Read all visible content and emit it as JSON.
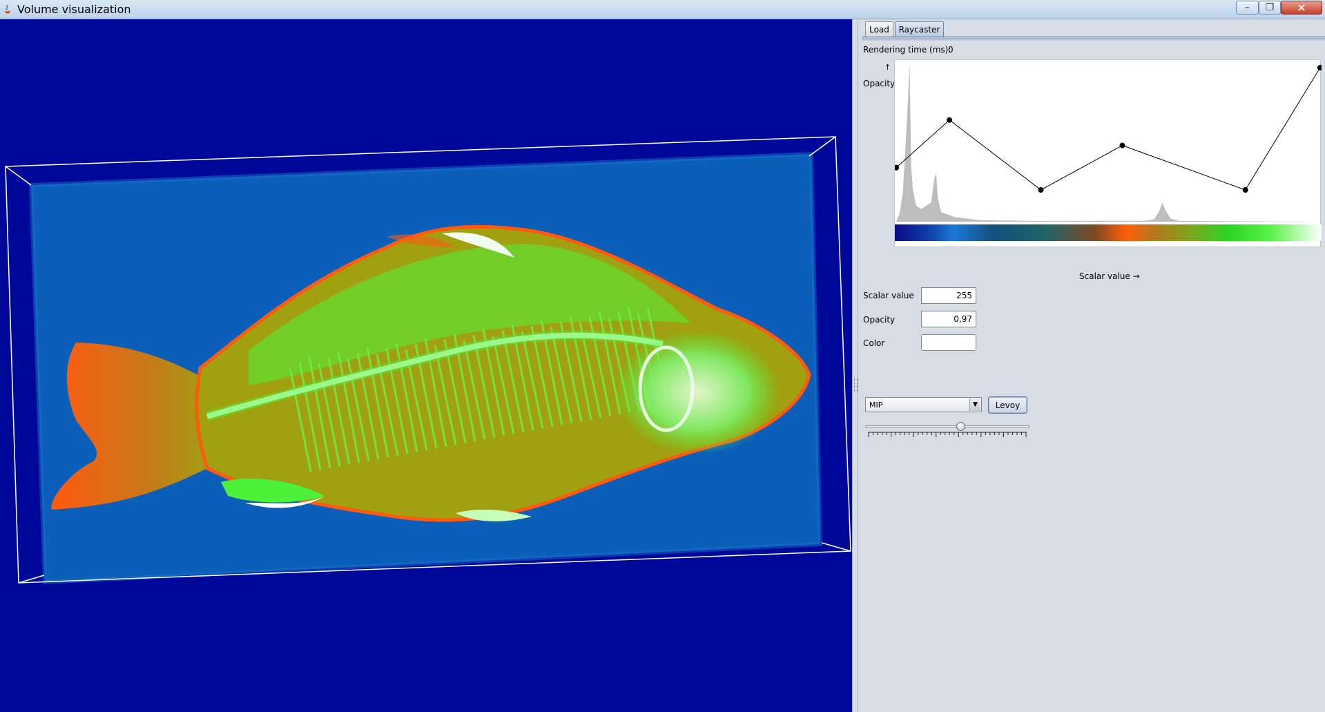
{
  "window": {
    "title": "Volume visualization",
    "controls": [
      "minimize",
      "maximize",
      "close"
    ]
  },
  "tabs": [
    {
      "label": "Load",
      "selected": false
    },
    {
      "label": "Raycaster",
      "selected": true
    }
  ],
  "panel": {
    "rendering_time_label": "Rendering time (ms):",
    "rendering_time_value": "0",
    "opacity_axis_arrow": "↑",
    "opacity_axis_label": "Opacity",
    "scalar_axis_label": "Scalar value →",
    "fields": {
      "scalar_value_label": "Scalar value",
      "scalar_value": "255",
      "opacity_label": "Opacity",
      "opacity": "0,97",
      "color_label": "Color",
      "color": "#ffffff"
    },
    "render_mode": {
      "selected": "MIP"
    },
    "levoy_label": "Levoy",
    "slider": {
      "value_fraction": 0.58,
      "tick_count": 36
    }
  },
  "transfer_function": {
    "control_points": [
      {
        "scalar": 0,
        "opacity": 0.34
      },
      {
        "scalar": 32,
        "opacity": 0.64
      },
      {
        "scalar": 87,
        "opacity": 0.2
      },
      {
        "scalar": 136,
        "opacity": 0.48
      },
      {
        "scalar": 210,
        "opacity": 0.2
      },
      {
        "scalar": 255,
        "opacity": 0.97
      }
    ],
    "colormap_stops": [
      {
        "scalar": 0,
        "color": "#0a0a8c"
      },
      {
        "scalar": 20,
        "color": "#0e3ea6"
      },
      {
        "scalar": 35,
        "color": "#1a78d6"
      },
      {
        "scalar": 60,
        "color": "#14507a"
      },
      {
        "scalar": 90,
        "color": "#206468"
      },
      {
        "scalar": 120,
        "color": "#7e4a22"
      },
      {
        "scalar": 138,
        "color": "#ff5f0a"
      },
      {
        "scalar": 155,
        "color": "#b4781c"
      },
      {
        "scalar": 175,
        "color": "#82a21e"
      },
      {
        "scalar": 200,
        "color": "#2ad624"
      },
      {
        "scalar": 225,
        "color": "#5cf24a"
      },
      {
        "scalar": 255,
        "color": "#ffffff"
      }
    ],
    "histogram": [
      {
        "scalar": 0,
        "height": 0.0
      },
      {
        "scalar": 2,
        "height": 0.05
      },
      {
        "scalar": 4,
        "height": 0.18
      },
      {
        "scalar": 6,
        "height": 0.55
      },
      {
        "scalar": 7,
        "height": 0.75
      },
      {
        "scalar": 8,
        "height": 1.0
      },
      {
        "scalar": 9,
        "height": 0.35
      },
      {
        "scalar": 10,
        "height": 0.2
      },
      {
        "scalar": 12,
        "height": 0.1
      },
      {
        "scalar": 15,
        "height": 0.08
      },
      {
        "scalar": 21,
        "height": 0.12
      },
      {
        "scalar": 23,
        "height": 0.28
      },
      {
        "scalar": 24,
        "height": 0.3
      },
      {
        "scalar": 25,
        "height": 0.15
      },
      {
        "scalar": 27,
        "height": 0.06
      },
      {
        "scalar": 35,
        "height": 0.03
      },
      {
        "scalar": 50,
        "height": 0.01
      },
      {
        "scalar": 80,
        "height": 0.005
      },
      {
        "scalar": 150,
        "height": 0.006
      },
      {
        "scalar": 155,
        "height": 0.015
      },
      {
        "scalar": 158,
        "height": 0.06
      },
      {
        "scalar": 160,
        "height": 0.12
      },
      {
        "scalar": 162,
        "height": 0.07
      },
      {
        "scalar": 165,
        "height": 0.02
      },
      {
        "scalar": 170,
        "height": 0.005
      },
      {
        "scalar": 255,
        "height": 0.0
      }
    ]
  },
  "colors": {
    "background": "#000899",
    "volume_slab": "#0b5fb8",
    "fish_body": "#a0a010",
    "fish_bones": "#4cf23a",
    "fish_edge": "#ff5a10"
  }
}
